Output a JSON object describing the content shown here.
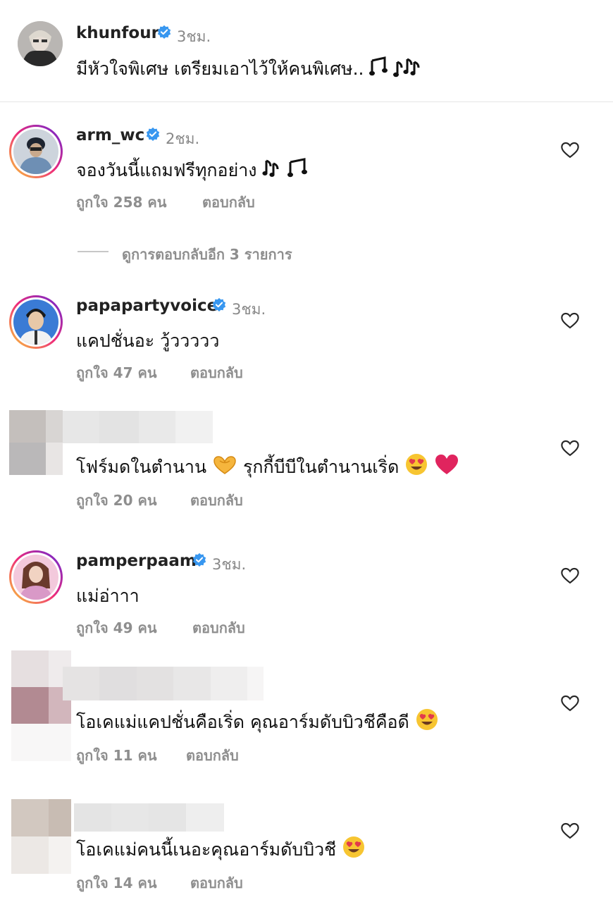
{
  "caption": {
    "username": "khunfour",
    "verified": true,
    "time": "3ชม.",
    "text": "มีหัวใจพิเศษ เตรียมเอาไว้ให้คนพิเศษ.."
  },
  "comments": [
    {
      "username": "arm_wc",
      "verified": true,
      "time": "2ชม.",
      "text": "จองวันนี้แถมฟรีทุกอย่าง",
      "likes": "ถูกใจ 258 คน",
      "reply": "ตอบกลับ"
    },
    {
      "username": "papapartyvoice",
      "verified": true,
      "time": "3ชม.",
      "text": "แคปชั่นอะ วู้ววววว",
      "likes": "ถูกใจ 47 คน",
      "reply": "ตอบกลับ"
    },
    {
      "username": "",
      "verified": false,
      "time": "",
      "text_a": "โฟร์มดในตำนาน",
      "text_b": "รุกกี้บีบีในตำนานเริ่ด",
      "likes": "ถูกใจ 20 คน",
      "reply": "ตอบกลับ"
    },
    {
      "username": "pamperpaam",
      "verified": true,
      "time": "3ชม.",
      "text": "แม่อ่าาา",
      "likes": "ถูกใจ 49 คน",
      "reply": "ตอบกลับ"
    },
    {
      "username": "",
      "verified": false,
      "time": "",
      "text": "โอเคแม่แคปชั่นคือเริ่ด คุณอาร์มดับบิวชีคือดี",
      "likes": "ถูกใจ 11 คน",
      "reply": "ตอบกลับ"
    },
    {
      "username": "",
      "verified": false,
      "time": "",
      "text": "โอเคแม่คนนี้เนอะคุณอาร์มดับบิวชี",
      "likes": "ถูกใจ 14 คน",
      "reply": "ตอบกลับ"
    }
  ],
  "view_replies": "ดูการตอบกลับอีก 3 รายการ",
  "colors": {
    "verified": "#3897f0",
    "meta": "#8e8e8e",
    "heart_outline": "#262626",
    "emoji_heart": "#e0245e"
  },
  "icons": [
    "verified-badge-icon",
    "heart-outline-icon",
    "music-notes-icon",
    "heart-hands-icon",
    "heart-eyes-emoji-icon",
    "red-heart-icon"
  ]
}
